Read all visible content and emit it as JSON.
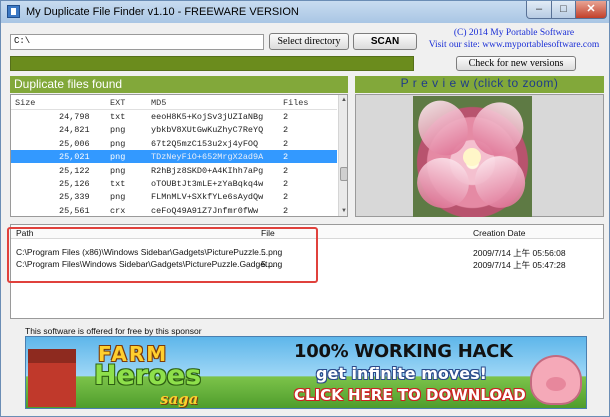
{
  "window": {
    "title": "My Duplicate File Finder v1.10 - FREEWARE VERSION",
    "controls": {
      "minimize": "–",
      "maximize": "□",
      "close": "✕"
    }
  },
  "toolbar": {
    "path_value": "C:\\",
    "select_directory_label": "Select directory",
    "scan_label": "SCAN",
    "copyright_line1": "(C) 2014 My Portable Software",
    "copyright_line2": "Visit our site: www.myportablesoftware.com",
    "check_versions_label": "Check for new versions"
  },
  "duplicates": {
    "header": "Duplicate files found",
    "columns": {
      "size": "Size",
      "ext": "EXT",
      "md5": "MD5",
      "files": "Files"
    },
    "rows": [
      {
        "size": "24,798",
        "ext": "txt",
        "md5": "eeoH8K5+KojSv3jUZIaNBg",
        "files": "2"
      },
      {
        "size": "24,821",
        "ext": "png",
        "md5": "ybkbV8XUtGwKuZhyC7ReYQ",
        "files": "2"
      },
      {
        "size": "25,006",
        "ext": "png",
        "md5": "67t2Q5mzC153u2xj4yFOQ",
        "files": "2"
      },
      {
        "size": "25,021",
        "ext": "png",
        "md5": "TDzNeyFiO+652MrgX2ad9A",
        "files": "2",
        "selected": true
      },
      {
        "size": "25,122",
        "ext": "png",
        "md5": "R2hBjz8SKD0+A4KIhh7aPg",
        "files": "2"
      },
      {
        "size": "25,126",
        "ext": "txt",
        "md5": "oTOUBtJt3mLE+zYaBqkq4w",
        "files": "2"
      },
      {
        "size": "25,339",
        "ext": "png",
        "md5": "FLMnMLV+SXkfYLe6sAydQw",
        "files": "2"
      },
      {
        "size": "25,561",
        "ext": "crx",
        "md5": "ceFoQ49A91Z7Jnfmr0fWw",
        "files": "2"
      }
    ]
  },
  "preview": {
    "header": "P r e v i e w   (click to zoom)"
  },
  "files": {
    "columns": {
      "path": "Path",
      "file": "File",
      "date": "Creation Date"
    },
    "rows": [
      {
        "path": "C:\\Program Files (x86)\\Windows Sidebar\\Gadgets\\PicturePuzzle...",
        "file": "5.png",
        "date": "2009/7/14 上午 05:56:08"
      },
      {
        "path": "C:\\Program Files\\Windows Sidebar\\Gadgets\\PicturePuzzle.Gadget...",
        "file": "5.png",
        "date": "2009/7/14 上午 05:47:28"
      }
    ]
  },
  "sponsor": {
    "text": "This software is offered for free by this sponsor",
    "ad": {
      "logo_farm": "FARM",
      "logo_heroes": "Heroes",
      "logo_saga": "saga",
      "line1": "100% WORKING HACK",
      "line2": "get infinite moves!",
      "line3": "CLICK HERE TO DOWNLOAD"
    }
  },
  "colors": {
    "accent_green": "#82a83a",
    "progress_green": "#6b8c1d",
    "selection_blue": "#3399ff",
    "link_blue": "#1a2ed6",
    "highlight_red": "#e0413c"
  }
}
